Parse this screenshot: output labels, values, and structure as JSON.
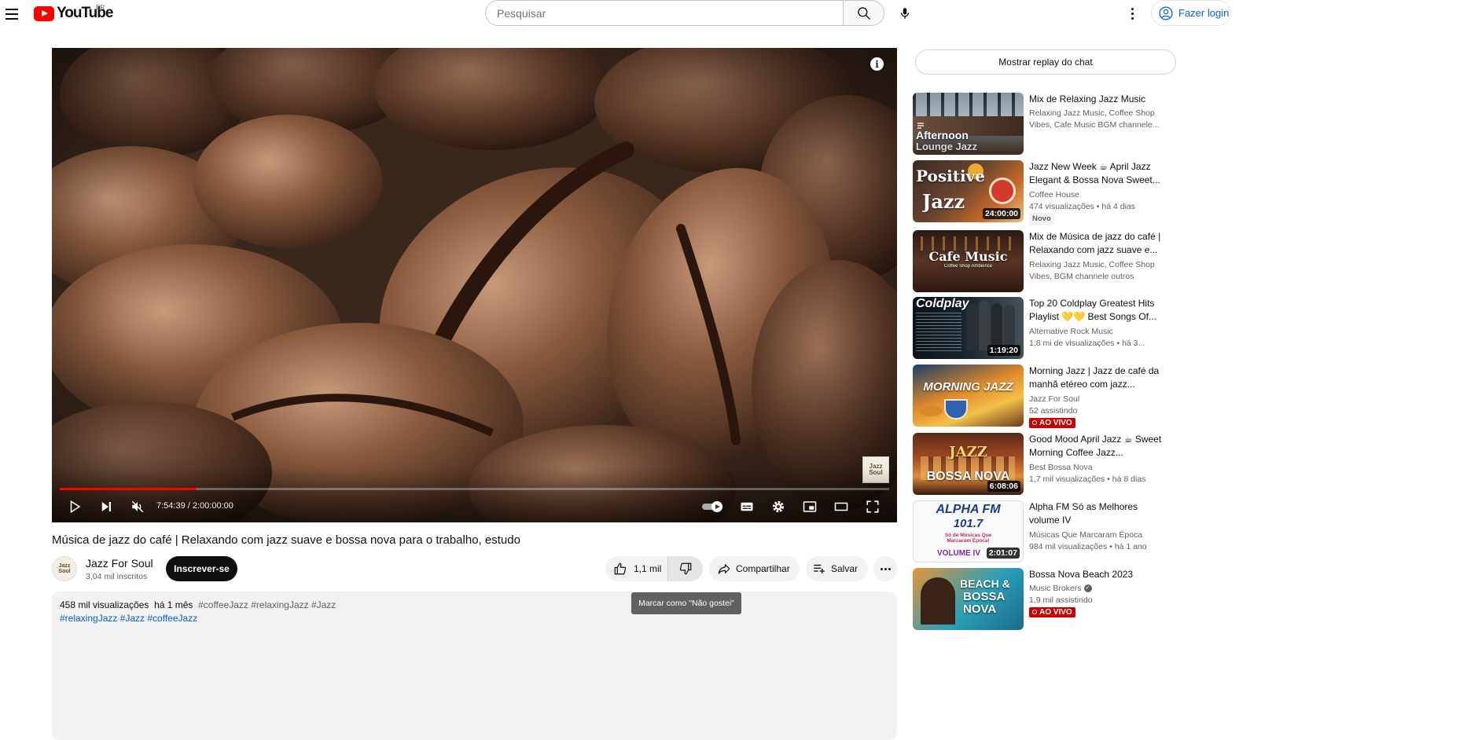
{
  "header": {
    "logo_text": "YouTube",
    "country_code": "BR",
    "search_placeholder": "Pesquisar",
    "login_label": "Fazer login"
  },
  "player": {
    "time_display": "7:54:39 / 2:00:00:00",
    "progress_fraction": 0.165,
    "watermark_text": "Jazz Soul"
  },
  "video": {
    "title": "Música de jazz do café | Relaxando com jazz suave e bossa nova para o trabalho, estudo",
    "channel_name": "Jazz For Soul",
    "channel_subs": "3,04 mil inscritos",
    "avatar_text": "Jazz Soul",
    "subscribe_label": "Inscrever-se",
    "like_count": "1,1 mil",
    "share_label": "Compartilhar",
    "save_label": "Salvar",
    "dislike_tooltip": "Marcar como \"Não gostei\""
  },
  "description": {
    "views": "458 mil visualizações",
    "age": "há 1 mês",
    "tags_line1": "#coffeeJazz #relaxingJazz #Jazz",
    "tags_line2": "#relaxingJazz #Jazz #coffeeJazz"
  },
  "sidebar": {
    "chat_replay_label": "Mostrar replay do chat",
    "items": [
      {
        "title": "Mix de Relaxing Jazz Music",
        "meta1": "Relaxing Jazz Music, Coffee Shop",
        "meta2": "Vibes, Cafe Music BGM channele...",
        "thumb_text": "Afternoon",
        "thumb_text2": "Lounge Jazz"
      },
      {
        "title": "Jazz New Week ☕ April Jazz Elegant & Bossa Nova Sweet...",
        "meta1": "Coffee House",
        "meta2": "474 visualizações • há 4 dias",
        "badge": "Novo",
        "duration": "24:00:00",
        "thumb_text": "Positive",
        "thumb_text2": "Jazz"
      },
      {
        "title": "Mix de Música de jazz do café | Relaxando com jazz suave e...",
        "meta1": "Relaxing Jazz Music, Coffee Shop",
        "meta2": "Vibes, BGM channele outros",
        "thumb_text": "Cafe Music",
        "thumb_text2": "Coffee Shop Ambience"
      },
      {
        "title": "Top 20 Coldplay Greatest Hits Playlist 💛💛 Best Songs Of...",
        "meta1": "Alternative Rock Music",
        "meta2": "1,8 mi de visualizações • há 3...",
        "duration": "1:19:20",
        "thumb_text": "Coldplay"
      },
      {
        "title": "Morning Jazz | Jazz de café da manhã etéreo com jazz...",
        "meta1": "Jazz For Soul",
        "meta2": "52 assistindo",
        "live_label": "AO VIVO",
        "thumb_text": "MORNING JAZZ"
      },
      {
        "title": "Good Mood April Jazz ☕ Sweet Morning Coffee Jazz...",
        "meta1": "Best Bossa Nova",
        "meta2": "1,7 mil visualizações • há 8 dias",
        "duration": "6:08:06",
        "thumb_text": "JAZZ",
        "thumb_text2": "BOSSA NOVA"
      },
      {
        "title": "Alpha FM Só as Melhores volume IV",
        "meta1": "Músicas Que Marcaram Época",
        "meta2": "984 mil visualizações • há 1 ano",
        "duration": "2:01:07",
        "thumb_text": "ALPHA FM",
        "thumb_text2": "101.7",
        "thumb_text3": "Só de Músicas Que Marcaram Época!",
        "thumb_text4": "VOLUME IV"
      },
      {
        "title": "Bossa Nova Beach 2023",
        "meta1": "Music Brokers",
        "meta2": "1,9 mil assistindo",
        "live_label": "AO VIVO",
        "thumb_text": "BEACH &",
        "thumb_text2": "BOSSA",
        "thumb_text3": "NOVA"
      }
    ]
  },
  "colors": {
    "brand_red": "#ff0000",
    "link_blue": "#065fd4",
    "live_red": "#cc0000"
  }
}
